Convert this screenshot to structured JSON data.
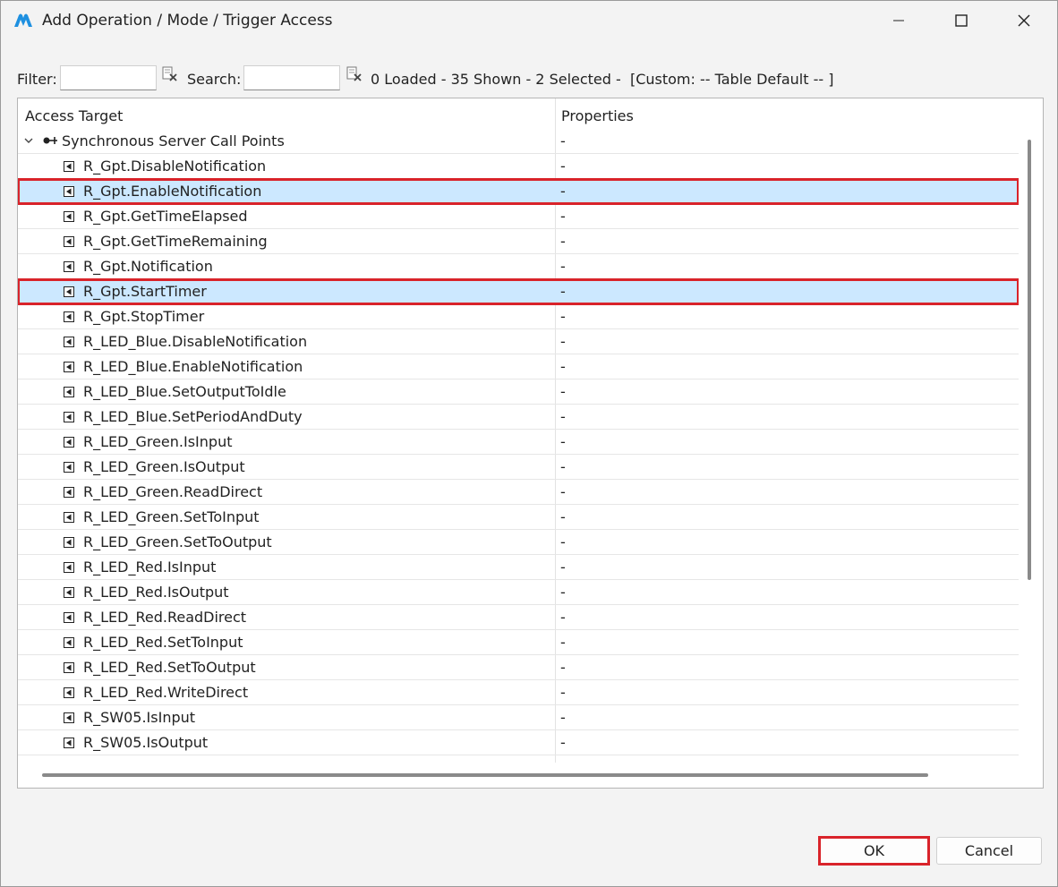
{
  "window": {
    "title": "Add Operation / Mode / Trigger Access",
    "controls": {
      "minimize": "minimize",
      "maximize": "maximize",
      "close": "close"
    }
  },
  "filterbar": {
    "filter_label": "Filter:",
    "filter_value": "",
    "search_label": "Search:",
    "search_value": "",
    "status": "0 Loaded - 35 Shown - 2 Selected -  [Custom: -- Table Default -- ]"
  },
  "table": {
    "columns": [
      "Access Target",
      "Properties"
    ],
    "group": {
      "label": "Synchronous Server Call Points",
      "property": "-",
      "expanded": true
    },
    "rows": [
      {
        "name": "R_Gpt.DisableNotification",
        "property": "-",
        "selected": false
      },
      {
        "name": "R_Gpt.EnableNotification",
        "property": "-",
        "selected": true
      },
      {
        "name": "R_Gpt.GetTimeElapsed",
        "property": "-",
        "selected": false
      },
      {
        "name": "R_Gpt.GetTimeRemaining",
        "property": "-",
        "selected": false
      },
      {
        "name": "R_Gpt.Notification",
        "property": "-",
        "selected": false
      },
      {
        "name": "R_Gpt.StartTimer",
        "property": "-",
        "selected": true
      },
      {
        "name": "R_Gpt.StopTimer",
        "property": "-",
        "selected": false
      },
      {
        "name": "R_LED_Blue.DisableNotification",
        "property": "-",
        "selected": false
      },
      {
        "name": "R_LED_Blue.EnableNotification",
        "property": "-",
        "selected": false
      },
      {
        "name": "R_LED_Blue.SetOutputToIdle",
        "property": "-",
        "selected": false
      },
      {
        "name": "R_LED_Blue.SetPeriodAndDuty",
        "property": "-",
        "selected": false
      },
      {
        "name": "R_LED_Green.IsInput",
        "property": "-",
        "selected": false
      },
      {
        "name": "R_LED_Green.IsOutput",
        "property": "-",
        "selected": false
      },
      {
        "name": "R_LED_Green.ReadDirect",
        "property": "-",
        "selected": false
      },
      {
        "name": "R_LED_Green.SetToInput",
        "property": "-",
        "selected": false
      },
      {
        "name": "R_LED_Green.SetToOutput",
        "property": "-",
        "selected": false
      },
      {
        "name": "R_LED_Red.IsInput",
        "property": "-",
        "selected": false
      },
      {
        "name": "R_LED_Red.IsOutput",
        "property": "-",
        "selected": false
      },
      {
        "name": "R_LED_Red.ReadDirect",
        "property": "-",
        "selected": false
      },
      {
        "name": "R_LED_Red.SetToInput",
        "property": "-",
        "selected": false
      },
      {
        "name": "R_LED_Red.SetToOutput",
        "property": "-",
        "selected": false
      },
      {
        "name": "R_LED_Red.WriteDirect",
        "property": "-",
        "selected": false
      },
      {
        "name": "R_SW05.IsInput",
        "property": "-",
        "selected": false
      },
      {
        "name": "R_SW05.IsOutput",
        "property": "-",
        "selected": false
      }
    ]
  },
  "buttons": {
    "ok": "OK",
    "cancel": "Cancel"
  },
  "colors": {
    "selection": "#cce8ff",
    "highlight_border": "#d9232a",
    "logo": "#1e90e0"
  },
  "icons": {
    "logo": "app-logo-icon",
    "clear": "clear-filter-icon",
    "group": "server-call-group-icon",
    "leaf": "operation-leaf-icon",
    "expand": "chevron-down-icon"
  }
}
